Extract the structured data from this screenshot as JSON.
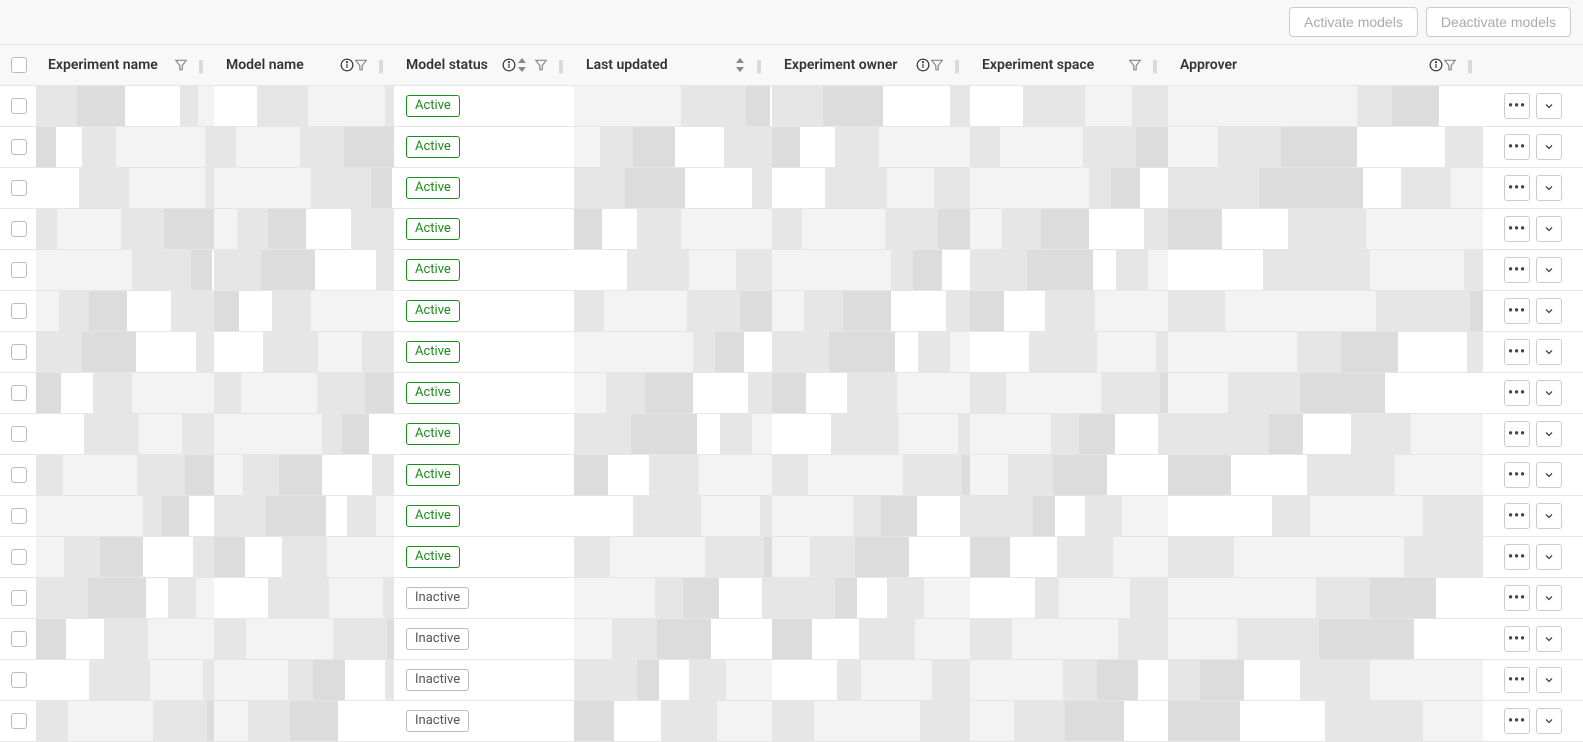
{
  "toolbar": {
    "activate_label": "Activate models",
    "deactivate_label": "Deactivate models"
  },
  "columns": {
    "experiment_name": "Experiment name",
    "model_name": "Model name",
    "model_status": "Model status",
    "last_updated": "Last updated",
    "experiment_owner": "Experiment owner",
    "experiment_space": "Experiment space",
    "approver": "Approver"
  },
  "status_labels": {
    "active": "Active",
    "inactive": "Inactive"
  },
  "rows": [
    {
      "status": "active"
    },
    {
      "status": "active"
    },
    {
      "status": "active"
    },
    {
      "status": "active"
    },
    {
      "status": "active"
    },
    {
      "status": "active"
    },
    {
      "status": "active"
    },
    {
      "status": "active"
    },
    {
      "status": "active"
    },
    {
      "status": "active"
    },
    {
      "status": "active"
    },
    {
      "status": "active"
    },
    {
      "status": "inactive"
    },
    {
      "status": "inactive"
    },
    {
      "status": "inactive"
    },
    {
      "status": "inactive"
    }
  ]
}
